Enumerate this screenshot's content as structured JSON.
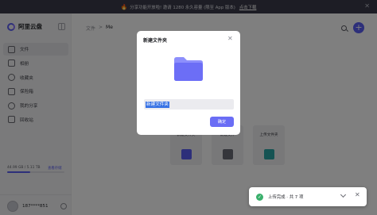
{
  "banner": {
    "text": "分享功能开放啦! 邀请 1280 永久容量 (限至 App 版本)",
    "link": "点击下载",
    "close_glyph": "✕"
  },
  "sidebar": {
    "brand": "阿里云盘",
    "items": [
      {
        "label": "文件",
        "icon": "folder-icon",
        "active": true
      },
      {
        "label": "相册",
        "icon": "photo-icon",
        "active": false
      },
      {
        "label": "收藏夹",
        "icon": "star-icon",
        "active": false
      },
      {
        "label": "保险箱",
        "icon": "safe-icon",
        "active": false
      },
      {
        "label": "我的分享",
        "icon": "share-icon",
        "active": false
      },
      {
        "label": "回收站",
        "icon": "trash-icon",
        "active": false
      }
    ],
    "storage_text": "44.99 GB / 5.11 TB",
    "storage_link": "查看存储",
    "storage_fraction": 0.4,
    "user_name": "187****851"
  },
  "main": {
    "breadcrumb_root": "文件",
    "breadcrumb_sep": ">",
    "breadcrumb_current": "Me",
    "drop_text": "盘",
    "add_glyph": "+",
    "tiles": [
      {
        "label": "新建文件夹",
        "icon": "new-folder-icon",
        "color": "#5b5ef5"
      },
      {
        "label": "新建文件",
        "icon": "new-file-icon",
        "color": "#6b6c77"
      },
      {
        "label": "上传文件夹",
        "icon": "upload-folder-icon",
        "color": "#2aa7a7"
      }
    ]
  },
  "modal": {
    "title": "新建文件夹",
    "close_glyph": "✕",
    "input_value": "新建文件夹",
    "ok_label": "确定"
  },
  "toast": {
    "text": "上传完成 · 共 7 项",
    "check_glyph": "✓",
    "close_glyph": "✕"
  },
  "colors": {
    "accent": "#5b5ef5",
    "success": "#3ab06c",
    "banner_bg": "#3a3b4a"
  }
}
